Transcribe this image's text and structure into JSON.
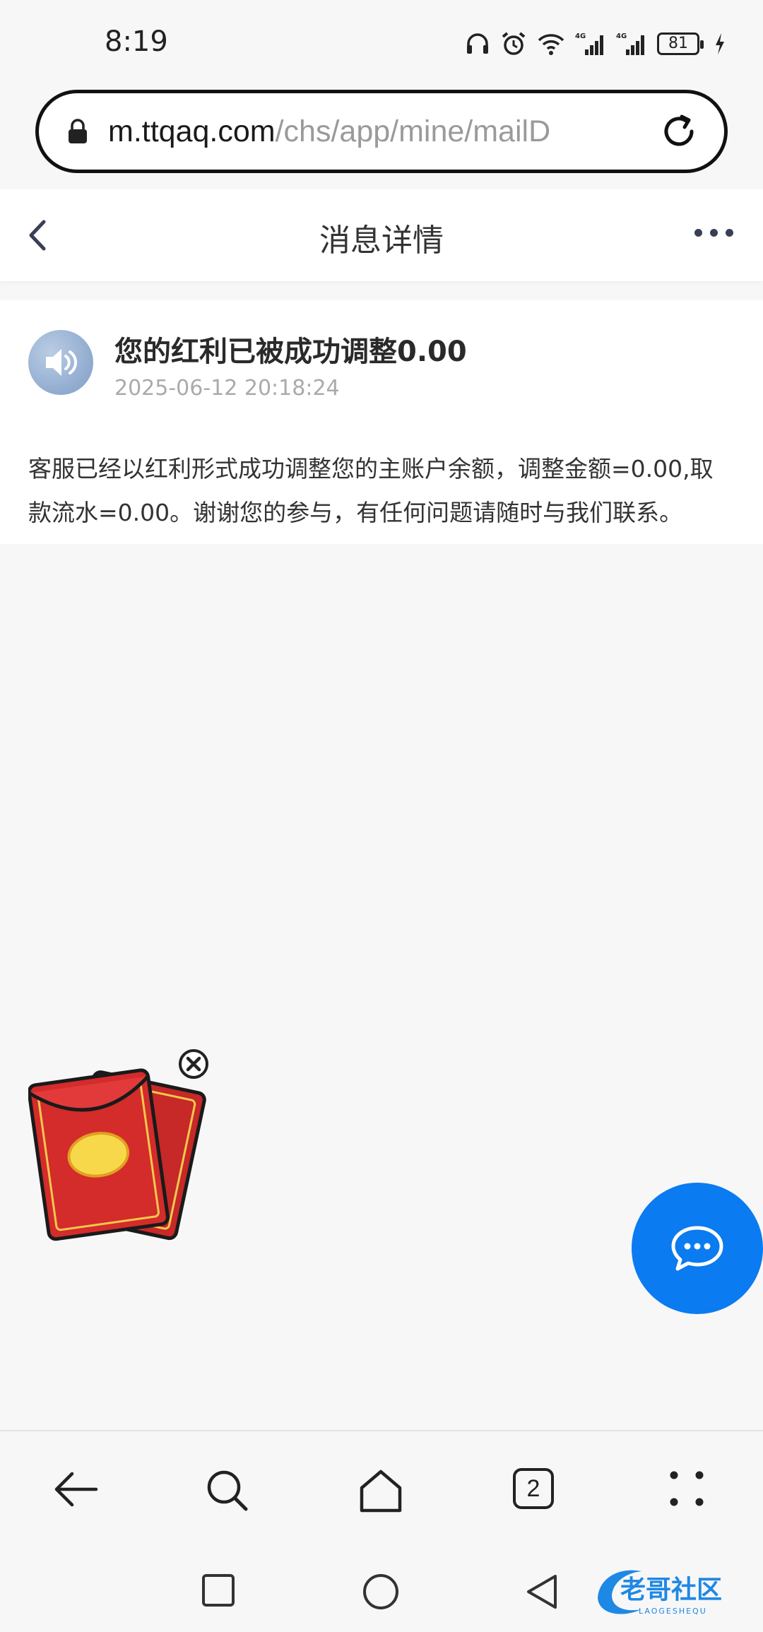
{
  "status_bar": {
    "time": "8:19",
    "battery": "81",
    "network_1": "4G",
    "network_2": "4G"
  },
  "url_bar": {
    "host": "m.ttqaq.com",
    "path": "/chs/app/mine/mailD"
  },
  "nav": {
    "title": "消息详情"
  },
  "message": {
    "title": "您的红利已被成功调整0.00",
    "timestamp": "2025-06-12 20:18:24",
    "body": "客服已经以红利形式成功调整您的主账户余额，调整金额=0.00,取款流水=0.00。谢谢您的参与，有任何问题请随时与我们联系。"
  },
  "browser_bar": {
    "tab_count": "2"
  },
  "watermark": {
    "text": "老哥社区",
    "sub": "LAOGESHEQU"
  },
  "colors": {
    "accent": "#0a7bf0",
    "background": "#f7f7f8",
    "red_packet": "#d42b2b"
  },
  "icons": [
    "lock-icon",
    "reload-icon",
    "back-icon",
    "more-icon",
    "speaker-icon",
    "red-packet-icon",
    "close-icon",
    "chat-icon",
    "arrow-back-icon",
    "search-icon",
    "home-icon",
    "tabs-icon",
    "menu-icon",
    "square-icon",
    "circle-icon",
    "triangle-icon"
  ]
}
